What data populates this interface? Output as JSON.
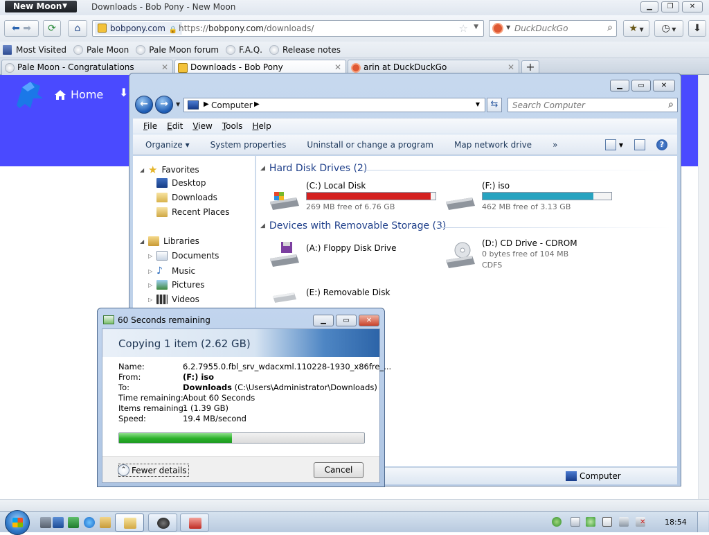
{
  "browser": {
    "app_menu_label": "New Moon",
    "window_title": "Downloads - Bob Pony - New Moon",
    "url_identity": "bobpony.com",
    "url_prefix": "https://",
    "url_host": "bobpony.com",
    "url_path": "/downloads/",
    "search_placeholder": "DuckDuckGo",
    "bookmarks": [
      "Most Visited",
      "Pale Moon",
      "Pale Moon forum",
      "F.A.Q.",
      "Release notes"
    ],
    "tabs": [
      {
        "label": "Pale Moon - Congratulations",
        "active": false
      },
      {
        "label": "Downloads - Bob Pony",
        "active": true
      },
      {
        "label": "arin at DuckDuckGo",
        "active": false
      }
    ]
  },
  "webpage": {
    "home_label": "Home",
    "banner_color": "#4a4aff"
  },
  "explorer": {
    "address_crumb": "Computer",
    "search_placeholder": "Search Computer",
    "menu": [
      {
        "key": "F",
        "rest": "ile"
      },
      {
        "key": "E",
        "rest": "dit"
      },
      {
        "key": "V",
        "rest": "iew"
      },
      {
        "key": "T",
        "rest": "ools"
      },
      {
        "key": "H",
        "rest": "elp"
      }
    ],
    "commands": [
      "Organize ▾",
      "System properties",
      "Uninstall or change a program",
      "Map network drive",
      "»"
    ],
    "nav": {
      "favorites": "Favorites",
      "favorites_items": [
        "Desktop",
        "Downloads",
        "Recent Places"
      ],
      "libraries": "Libraries",
      "libraries_items": [
        "Documents",
        "Music",
        "Pictures",
        "Videos"
      ]
    },
    "groups": {
      "hdd_header": "Hard Disk Drives (2)",
      "removable_header": "Devices with Removable Storage (3)"
    },
    "drives": {
      "c": {
        "name": "(C:) Local Disk",
        "free": "269 MB free of 6.76 GB",
        "used_fraction": 0.96,
        "bar_color": "#d42020"
      },
      "f": {
        "name": "(F:) iso",
        "free": "462 MB free of 3.13 GB",
        "used_fraction": 0.86,
        "bar_color": "#27a3c0"
      },
      "a": {
        "name": "(A:) Floppy Disk Drive"
      },
      "d": {
        "name": "(D:) CD Drive - CDROM",
        "free": "0 bytes free of 104 MB",
        "fs": "CDFS"
      },
      "e": {
        "name": "(E:) Removable Disk"
      }
    },
    "status_text": "Computer"
  },
  "copy_dialog": {
    "title": "60 Seconds remaining",
    "heading": "Copying 1 item (2.62 GB)",
    "rows": [
      {
        "label": "Name:",
        "value": "6.2.7955.0.fbl_srv_wdacxml.110228-1930_x86fre_...",
        "bold": ""
      },
      {
        "label": "From:",
        "value": "",
        "bold": "(F:) iso"
      },
      {
        "label": "To:",
        "value": " (C:\\Users\\Administrator\\Downloads)",
        "bold": "Downloads"
      },
      {
        "label": "Time remaining:",
        "value": "About 60 Seconds",
        "bold": ""
      },
      {
        "label": "Items remaining:",
        "value": "1 (1.39 GB)",
        "bold": ""
      },
      {
        "label": "Speed:",
        "value": "19.4 MB/second",
        "bold": ""
      }
    ],
    "progress": 0.46,
    "fewer_details": "Fewer details",
    "cancel": "Cancel"
  },
  "taskbar": {
    "clock": "18:54"
  }
}
